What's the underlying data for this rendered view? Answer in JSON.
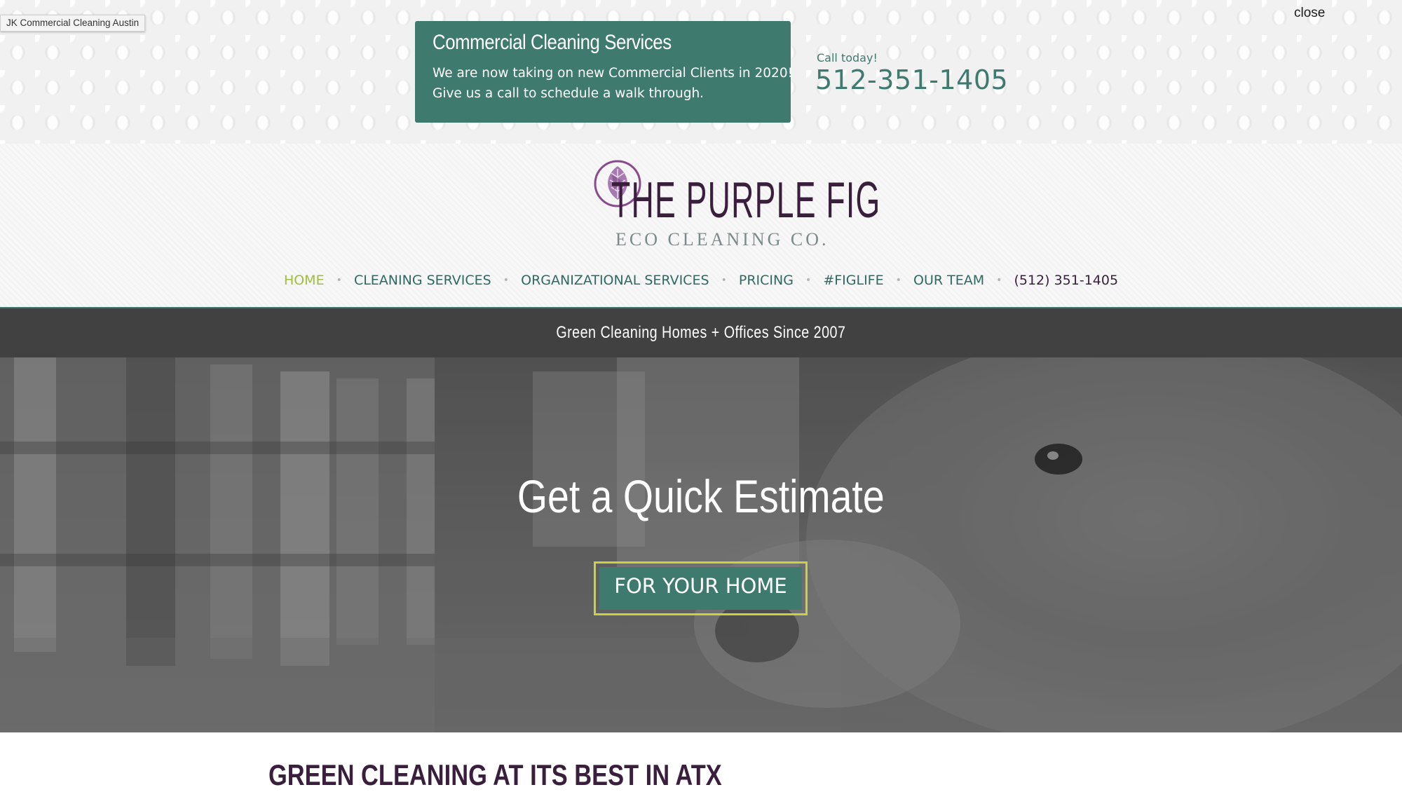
{
  "tooltip": {
    "text": "JK Commercial Cleaning Austin"
  },
  "promo": {
    "close_label": "close",
    "title": "Commercial Cleaning Services",
    "line1": "We are now taking on new Commercial Clients in 2020!",
    "line2": "Give us a call to schedule a walk through.",
    "call_label": "Call today!",
    "phone": "512-351-1405"
  },
  "logo": {
    "main": "THE PURPLE FIG",
    "sub": "ECO CLEANING CO."
  },
  "nav": {
    "items": [
      {
        "label": "HOME",
        "active": true
      },
      {
        "label": "CLEANING SERVICES"
      },
      {
        "label": "ORGANIZATIONAL SERVICES"
      },
      {
        "label": "PRICING"
      },
      {
        "label": "#FIGLIFE"
      },
      {
        "label": "OUR TEAM"
      },
      {
        "label": "(512) 351-1405"
      }
    ]
  },
  "tagline": "Green Cleaning Homes + Offices Since 2007",
  "hero": {
    "title": "Get a Quick Estimate",
    "button_label": "FOR YOUR HOME"
  },
  "section": {
    "heading": "GREEN CLEANING AT ITS BEST IN ATX"
  },
  "colors": {
    "teal": "#3f7a6f",
    "purple": "#3a1f3d",
    "lime_active": "#9fbd3f",
    "button_border": "#c8d23c",
    "tagline_bg": "#414141"
  }
}
